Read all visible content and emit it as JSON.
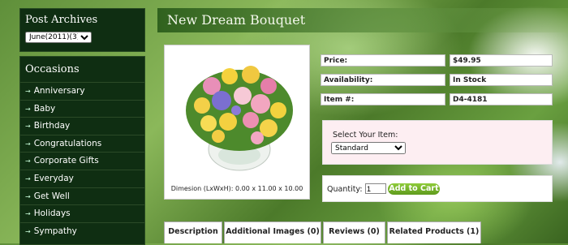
{
  "archives": {
    "title": "Post Archives",
    "selected": "June(2011)(3)"
  },
  "occasions": {
    "title": "Occasions",
    "items": [
      "Anniversary",
      "Baby",
      "Birthday",
      "Congratulations",
      "Corporate Gifts",
      "Everyday",
      "Get Well",
      "Holidays",
      "Sympathy"
    ]
  },
  "product": {
    "title": "New Dream Bouquet",
    "dimensions": "Dimesion (LxWxH): 0.00 x 11.00 x 10.00",
    "price_label": "Price:",
    "price": "$49.95",
    "availability_label": "Availability:",
    "availability": "In Stock",
    "item_label": "Item #:",
    "item_number": "D4-4181",
    "select_label": "Select Your Item:",
    "select_value": "Standard",
    "quantity_label": "Quantity:",
    "quantity": "1",
    "add_to_cart": "Add to Cart"
  },
  "tabs": [
    "Description",
    "Additional Images (0)",
    "Reviews (0)",
    "Related Products (1)"
  ]
}
